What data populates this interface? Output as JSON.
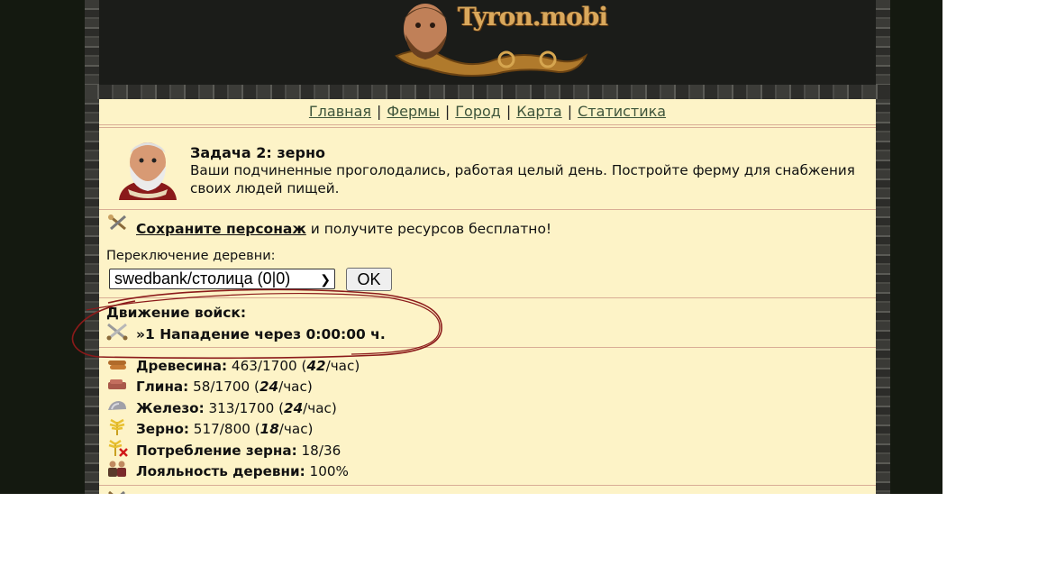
{
  "logo": {
    "text": "Tyron.mobi"
  },
  "nav": {
    "items": [
      "Главная",
      "Фермы",
      "Город",
      "Карта",
      "Статистика"
    ],
    "separator": "|"
  },
  "quest": {
    "title": "Задача 2: зерно",
    "text": "Ваши подчиненные проголодались, работая целый день. Постройте ферму для снабжения своих людей пищей."
  },
  "save": {
    "link": "Сохраните персонаж",
    "rest": " и получите ресурсов бесплатно!"
  },
  "village_switch": {
    "label": "Переключение деревни:",
    "selected": "swedbank/столица (0|0)",
    "ok": "OK"
  },
  "troops": {
    "title": "Движение войск:",
    "attack": "»1 Нападение через 0:00:00 ч."
  },
  "resources": {
    "wood": {
      "label": "Древесина:",
      "amount": "463/1700",
      "open": " (",
      "rate": "42",
      "unit": "/час)"
    },
    "clay": {
      "label": "Глина:",
      "amount": "58/1700",
      "open": " (",
      "rate": "24",
      "unit": "/час)"
    },
    "iron": {
      "label": "Железо:",
      "amount": "313/1700",
      "open": " (",
      "rate": "24",
      "unit": "/час)"
    },
    "grain": {
      "label": "Зерно:",
      "amount": "517/800",
      "open": " (",
      "rate": "18",
      "unit": "/час)"
    },
    "consumption": {
      "label": "Потребление зерна:",
      "value": "18/36"
    },
    "loyalty": {
      "label": "Лояльность деревни:",
      "value": "100%"
    }
  },
  "colors": {
    "content_bg": "#fdf3c7",
    "nav_link": "#3f553b",
    "separator": "#d9ad95",
    "annotation": "#8b1a1a"
  }
}
